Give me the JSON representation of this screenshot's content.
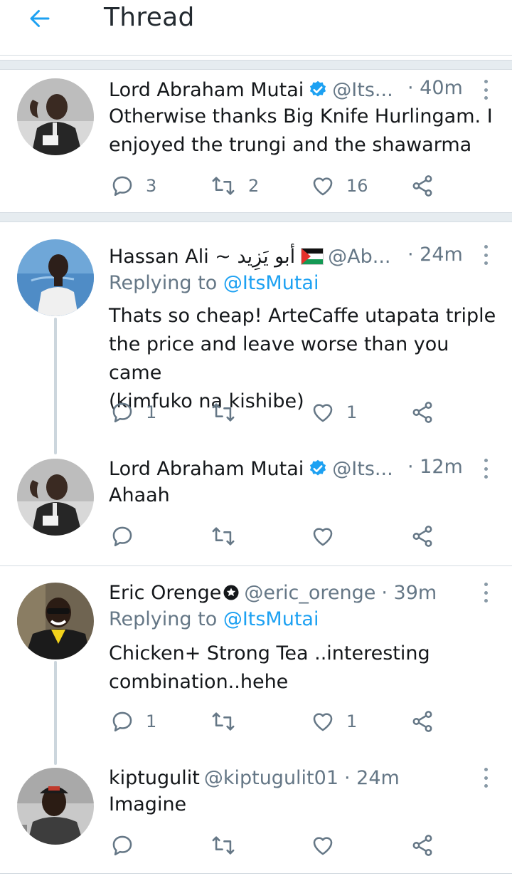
{
  "header": {
    "title": "Thread",
    "back_icon": "arrow-left-icon",
    "accent": "#1da1f2"
  },
  "tweets": [
    {
      "name": "Lord Abraham Mutai",
      "verified": true,
      "handle": "@Its...",
      "time": "· 40m",
      "replying": "",
      "text": "Otherwise thanks Big Knife Hurlingam. I\nenjoyed the trungi and the shawarma",
      "replies": "3",
      "retweets": "2",
      "likes": "16"
    },
    {
      "name": "Hassan Ali ~ أبو يَزِيد",
      "flag": "palestine-flag-icon",
      "handle": "@Ab...",
      "time": "· 24m",
      "replying_prefix": "Replying to ",
      "replying_mention": "@ItsMutai",
      "text": "Thats so cheap! ArteCaffe utapata triple\nthe price and leave worse than you came\n(kimfuko na kishibe)",
      "replies": "1",
      "retweets": "",
      "likes": "1"
    },
    {
      "name": "Lord Abraham Mutai",
      "verified": true,
      "handle": "@Its...",
      "time": "· 12m",
      "text": "Ahaah",
      "replies": "",
      "retweets": "",
      "likes": ""
    },
    {
      "name": "Eric Orenge",
      "badge": "star-badge-icon",
      "handle": "@eric_orenge",
      "time": "· 39m",
      "replying_prefix": "Replying to ",
      "replying_mention": "@ItsMutai",
      "text": "Chicken+ Strong Tea ..interesting\ncombination..hehe",
      "replies": "1",
      "retweets": "",
      "likes": "1"
    },
    {
      "name": "kiptugulit",
      "handle": "@kiptugulit01",
      "time": "· 24m",
      "text": "Imagine",
      "replies": "",
      "retweets": "",
      "likes": ""
    }
  ]
}
